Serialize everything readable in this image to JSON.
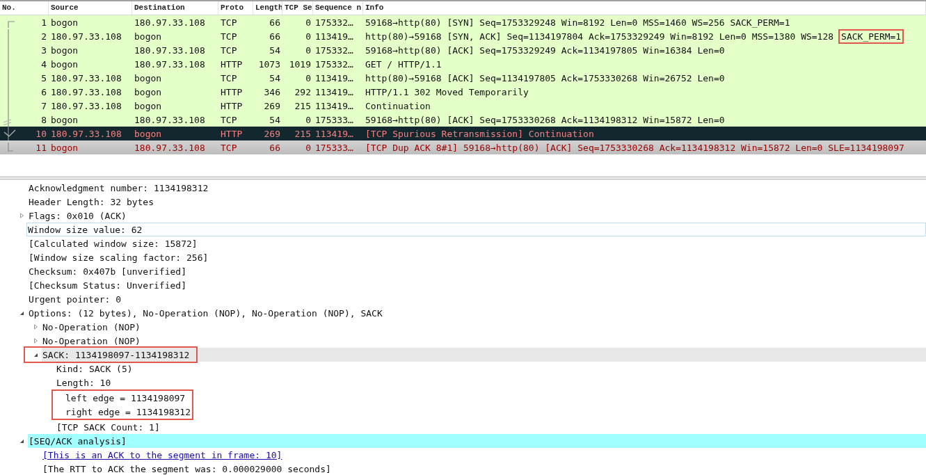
{
  "packet_list": {
    "columns": [
      "No.",
      "Source",
      "Destination",
      "Proto",
      "Length",
      "TCP Se",
      "Sequence n",
      "Info"
    ],
    "rows": [
      {
        "no": "1",
        "source": "bogon",
        "destination": "180.97.33.108",
        "protocol": "TCP",
        "length": "66",
        "tcp_segment_len": "0",
        "sequence": "175332…",
        "info": "59168→http(80) [SYN] Seq=1753329248 Win=8192 Len=0 MSS=1460 WS=256 SACK_PERM=1",
        "color": "#e4ffc7",
        "selected": false
      },
      {
        "no": "2",
        "source": "180.97.33.108",
        "destination": "bogon",
        "protocol": "TCP",
        "length": "66",
        "tcp_segment_len": "0",
        "sequence": "113419…",
        "info": "http(80)→59168 [SYN, ACK] Seq=1134197804 Ack=1753329249 Win=8192 Len=0 MSS=1380 WS=128",
        "info_annotated": "SACK_PERM=1",
        "color": "#e4ffc7",
        "selected": false
      },
      {
        "no": "3",
        "source": "bogon",
        "destination": "180.97.33.108",
        "protocol": "TCP",
        "length": "54",
        "tcp_segment_len": "0",
        "sequence": "175332…",
        "info": "59168→http(80) [ACK] Seq=1753329249 Ack=1134197805 Win=16384 Len=0",
        "color": "#e4ffc7",
        "selected": false
      },
      {
        "no": "4",
        "source": "bogon",
        "destination": "180.97.33.108",
        "protocol": "HTTP",
        "length": "1073",
        "tcp_segment_len": "1019",
        "sequence": "175332…",
        "info": "GET / HTTP/1.1",
        "color": "#e4ffc7",
        "selected": false
      },
      {
        "no": "5",
        "source": "180.97.33.108",
        "destination": "bogon",
        "protocol": "TCP",
        "length": "54",
        "tcp_segment_len": "0",
        "sequence": "113419…",
        "info": "http(80)→59168 [ACK] Seq=1134197805 Ack=1753330268 Win=26752 Len=0",
        "color": "#e4ffc7",
        "selected": false
      },
      {
        "no": "6",
        "source": "180.97.33.108",
        "destination": "bogon",
        "protocol": "HTTP",
        "length": "346",
        "tcp_segment_len": "292",
        "sequence": "113419…",
        "info": "HTTP/1.1 302 Moved Temporarily",
        "color": "#e4ffc7",
        "selected": false
      },
      {
        "no": "7",
        "source": "180.97.33.108",
        "destination": "bogon",
        "protocol": "HTTP",
        "length": "269",
        "tcp_segment_len": "215",
        "sequence": "113419…",
        "info": "Continuation",
        "color": "#e4ffc7",
        "selected": false
      },
      {
        "no": "8",
        "source": "bogon",
        "destination": "180.97.33.108",
        "protocol": "TCP",
        "length": "54",
        "tcp_segment_len": "0",
        "sequence": "175333…",
        "info": "59168→http(80) [ACK] Seq=1753330268 Ack=1134198312 Win=15872 Len=0",
        "color": "#e4ffc7",
        "selected": false
      },
      {
        "no": "10",
        "source": "180.97.33.108",
        "destination": "bogon",
        "protocol": "HTTP",
        "length": "269",
        "tcp_segment_len": "215",
        "sequence": "113419…",
        "info": "[TCP Spurious Retransmission] Continuation",
        "color": "#12272e",
        "selected": false
      },
      {
        "no": "11",
        "source": "bogon",
        "destination": "180.97.33.108",
        "protocol": "TCP",
        "length": "66",
        "tcp_segment_len": "0",
        "sequence": "175333…",
        "info": "[TCP Dup ACK 8#1] 59168→http(80) [ACK] Seq=1753330268 Ack=1134198312 Win=15872 Len=0 SLE=1134198097",
        "selected": true
      }
    ]
  },
  "details": {
    "items": [
      {
        "text": "Acknowledgment number: 1134198312"
      },
      {
        "text": "Header Length: 32 bytes"
      },
      {
        "text": "Flags: 0x010 (ACK)",
        "expanded": false
      },
      {
        "text": "Window size value: 62",
        "focused": true
      },
      {
        "text": "[Calculated window size: 15872]"
      },
      {
        "text": "[Window size scaling factor: 256]"
      },
      {
        "text": "Checksum: 0x407b [unverified]"
      },
      {
        "text": "[Checksum Status: Unverified]"
      },
      {
        "text": "Urgent pointer: 0"
      },
      {
        "text": "Options: (12 bytes), No-Operation (NOP), No-Operation (NOP), SACK",
        "expanded": true,
        "children": [
          {
            "text": "No-Operation (NOP)",
            "expanded": false
          },
          {
            "text": "No-Operation (NOP)",
            "expanded": false
          },
          {
            "text": "SACK: 1134198097-1134198312",
            "expanded": true,
            "hovered": true,
            "annotated": true,
            "children": [
              {
                "text": "Kind: SACK (5)"
              },
              {
                "text": "Length: 10"
              },
              {
                "text": "left edge = 1134198097",
                "annotated": true
              },
              {
                "text": "right edge = 1134198312",
                "annotated": true
              },
              {
                "text": "[TCP SACK Count: 1]"
              }
            ]
          }
        ]
      },
      {
        "text": "[SEQ/ACK analysis]",
        "expanded": true,
        "highlighted": true,
        "children": [
          {
            "text": "[This is an ACK to the segment in frame: 10]",
            "kind": "link"
          },
          {
            "text": "[The RTT to ACK the segment was: 0.000029000 seconds]"
          }
        ]
      }
    ]
  }
}
